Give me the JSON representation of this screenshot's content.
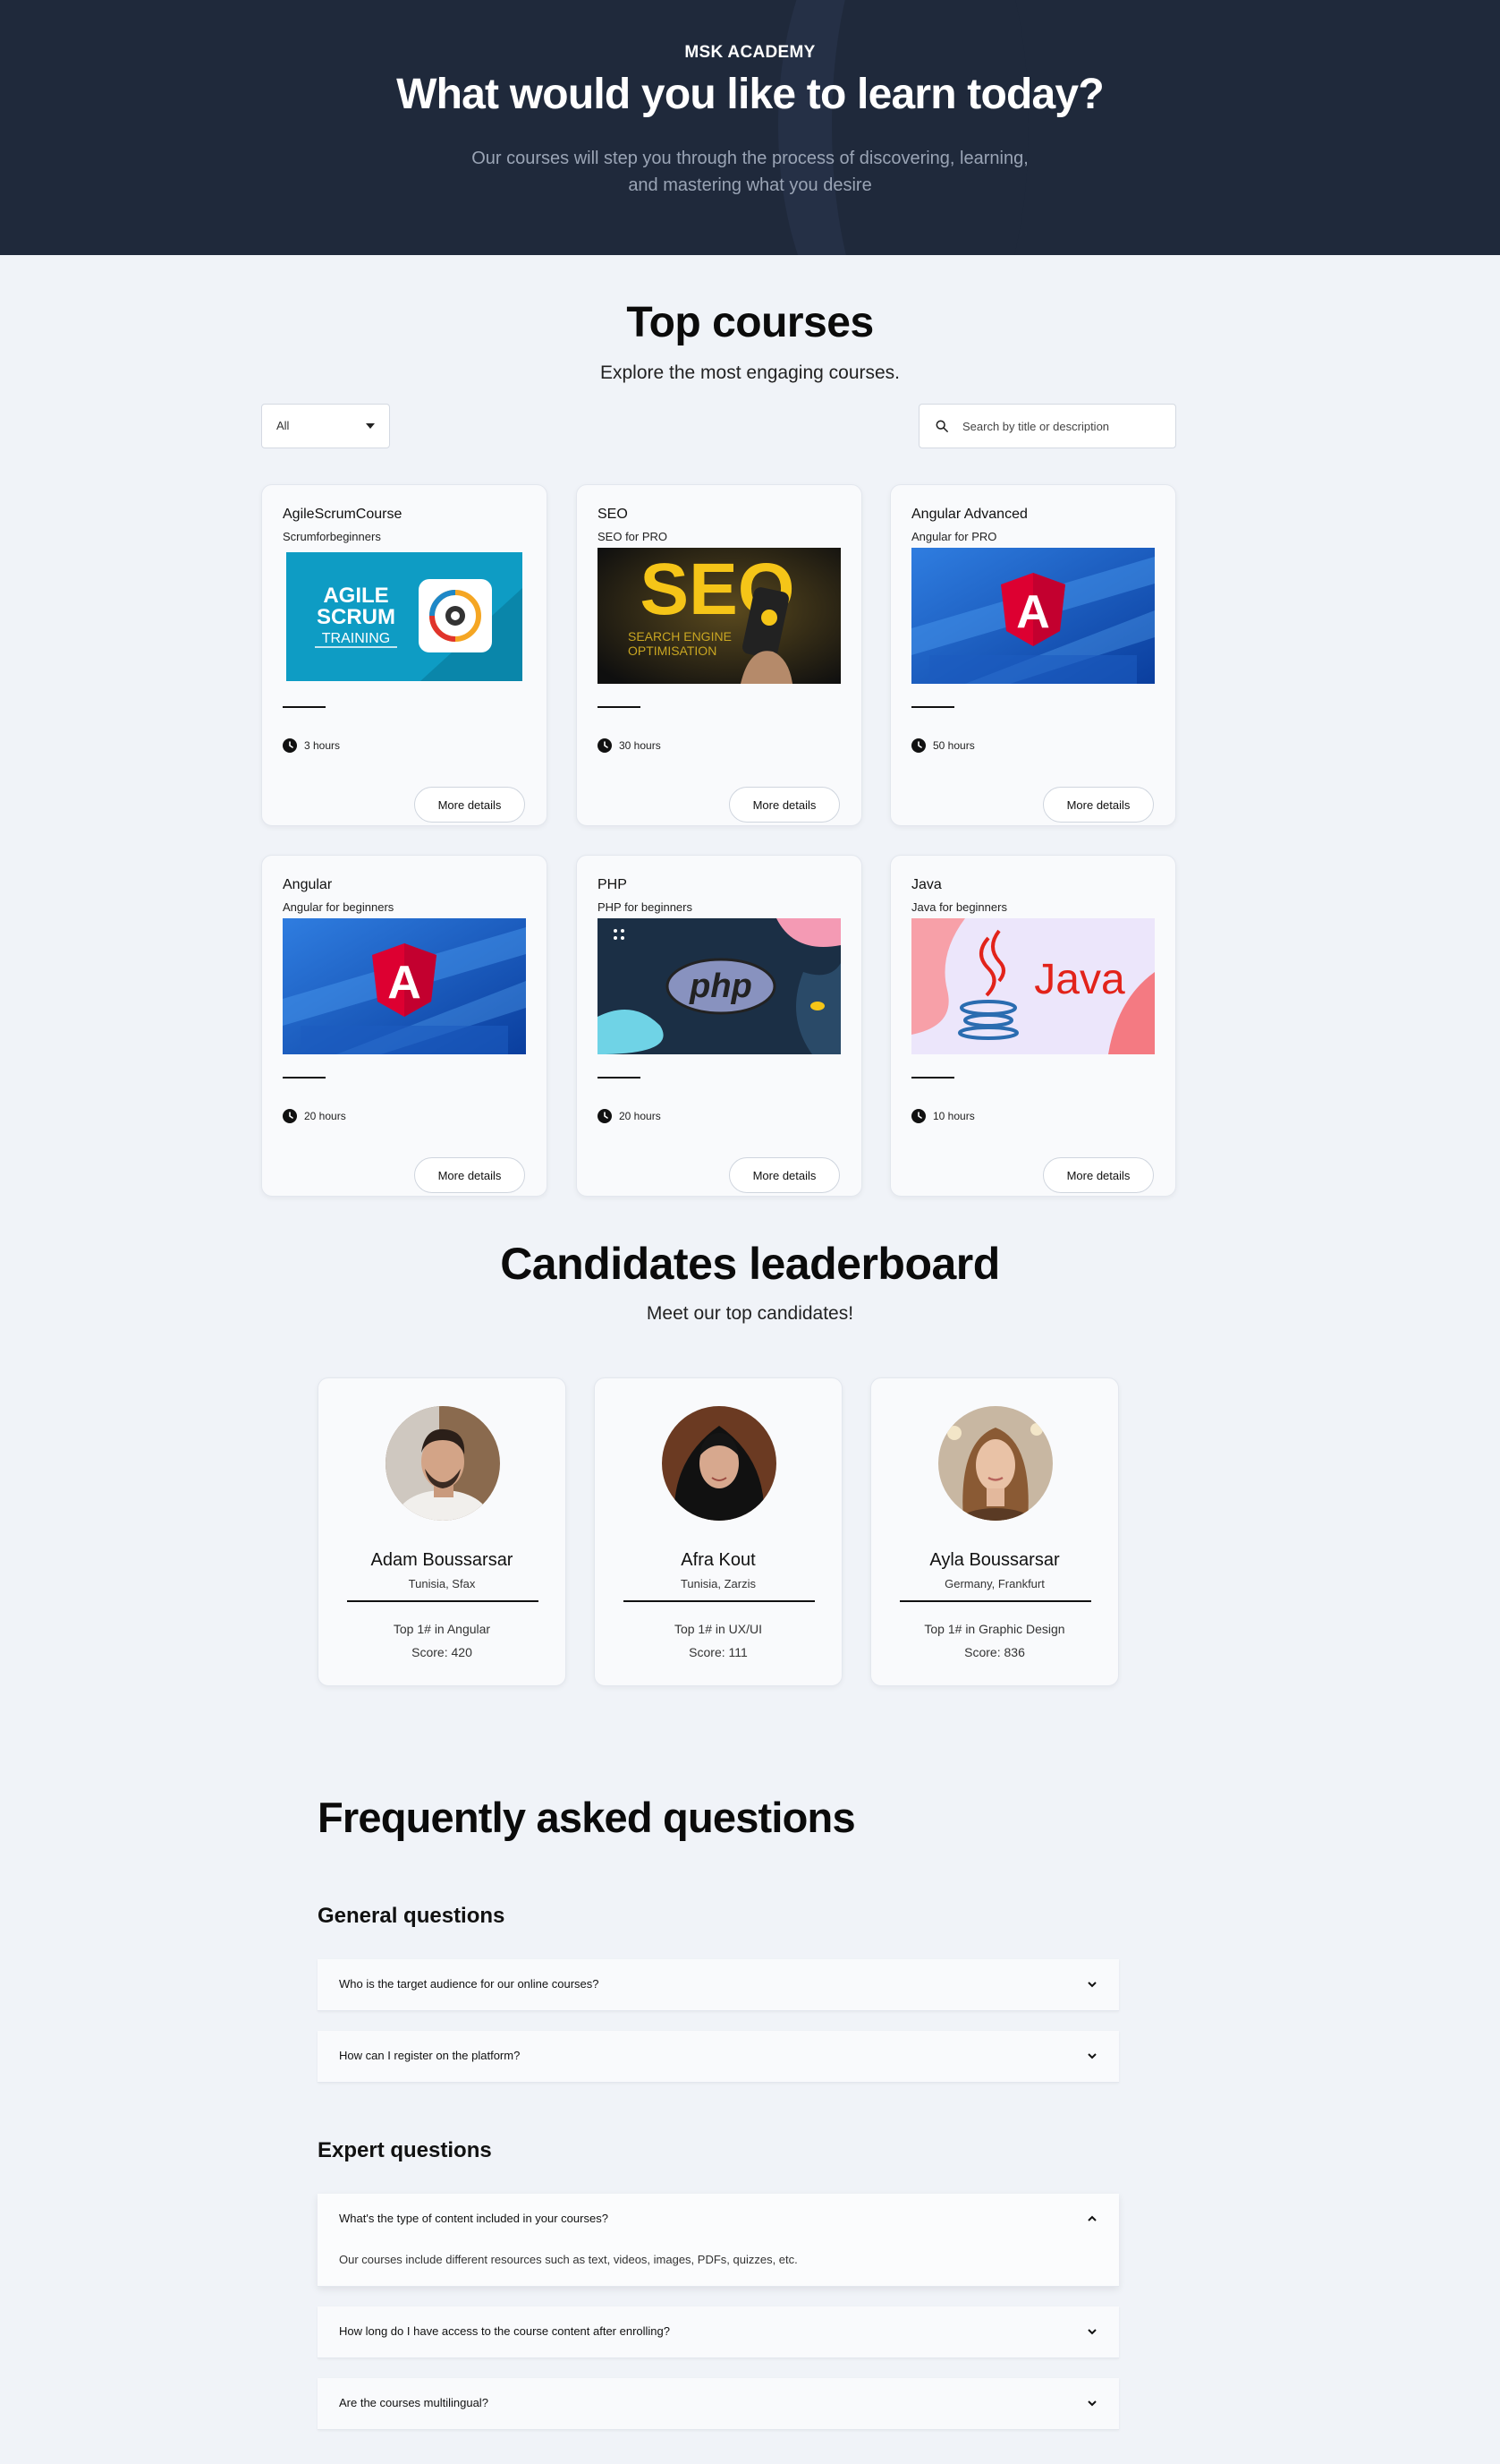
{
  "hero": {
    "brand": "MSK ACADEMY",
    "title": "What would you like to learn today?",
    "subtitle_line1": "Our courses will step you through the process of discovering, learning,",
    "subtitle_line2": "and mastering what you desire"
  },
  "courses_section": {
    "title": "Top courses",
    "subtitle": "Explore the most engaging courses.",
    "filter": {
      "selected": "All"
    },
    "search": {
      "placeholder": "Search by title or description",
      "value": ""
    },
    "more_label": "More details",
    "items": [
      {
        "title": "AgileScrumCourse",
        "subtitle": "Scrumforbeginners",
        "duration": "3 hours",
        "thumb_text_1": "AGILE",
        "thumb_text_2": "SCRUM",
        "thumb_text_3": "TRAINING"
      },
      {
        "title": "SEO",
        "subtitle": "SEO for PRO",
        "duration": "30 hours",
        "thumb_text_1": "SEO",
        "thumb_text_2": "SEARCH ENGINE",
        "thumb_text_3": "OPTIMISATION"
      },
      {
        "title": "Angular Advanced",
        "subtitle": "Angular for PRO",
        "duration": "50 hours",
        "thumb_text_1": "A"
      },
      {
        "title": "Angular",
        "subtitle": "Angular for beginners",
        "duration": "20 hours",
        "thumb_text_1": "A"
      },
      {
        "title": "PHP",
        "subtitle": "PHP for beginners",
        "duration": "20 hours",
        "thumb_text_1": "php"
      },
      {
        "title": "Java",
        "subtitle": "Java for beginners",
        "duration": "10 hours",
        "thumb_text_1": "Java"
      }
    ]
  },
  "leaderboard": {
    "title": "Candidates leaderboard",
    "subtitle": "Meet our top candidates!",
    "candidates": [
      {
        "name": "Adam Boussarsar",
        "location": "Tunisia, Sfax",
        "rank": "Top 1# in Angular",
        "score": "Score: 420"
      },
      {
        "name": "Afra Kout",
        "location": "Tunisia, Zarzis",
        "rank": "Top 1# in UX/UI",
        "score": "Score: 111"
      },
      {
        "name": "Ayla Boussarsar",
        "location": "Germany, Frankfurt",
        "rank": "Top 1# in Graphic Design",
        "score": "Score: 836"
      }
    ]
  },
  "faq": {
    "title": "Frequently asked questions",
    "general_title": "General questions",
    "general": [
      {
        "question": "Who is the target audience for our online courses?"
      },
      {
        "question": "How can I register on the platform?"
      }
    ],
    "expert_title": "Expert questions",
    "expert": [
      {
        "question": "What's the type of content included in your courses?",
        "answer": "Our courses include different resources such as text, videos, images, PDFs, quizzes, etc.",
        "expanded": true
      },
      {
        "question": "How long do I have access to the course content after enrolling?"
      },
      {
        "question": "Are the courses multilingual?"
      }
    ]
  },
  "colors": {
    "hero_bg": "#1f293b",
    "page_bg": "#f0f3f8",
    "angular_red": "#dd0031",
    "seo_yellow": "#f5c518",
    "scrum_teal": "#0e9cc4"
  }
}
